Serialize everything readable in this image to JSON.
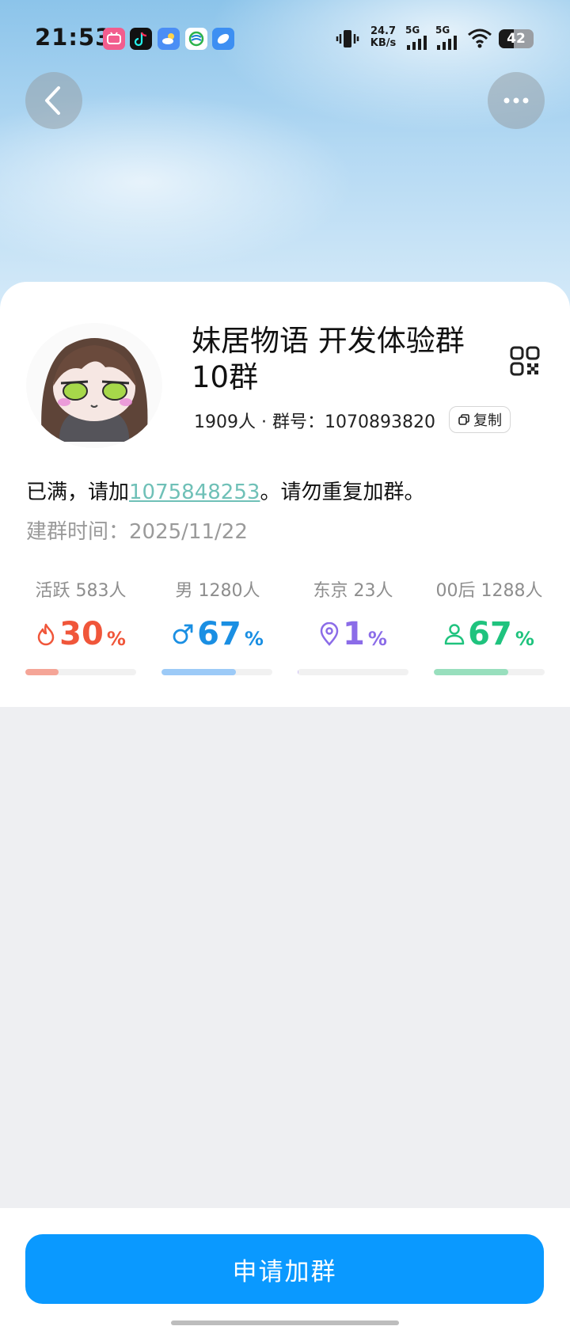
{
  "status_bar": {
    "time": "21:53",
    "net_speed_value": "24.7",
    "net_speed_unit": "KB/s",
    "signal1": "5G",
    "signal2": "5G",
    "battery": "42"
  },
  "group": {
    "name": "妹居物语 开发体验群10群",
    "members": "1909人",
    "id_label": "群号：",
    "id": "1070893820",
    "copy_label": "复制",
    "desc_prefix": "已满，请加",
    "desc_link": "1075848253",
    "desc_suffix": "。请勿重复加群。",
    "created_label": "建群时间：",
    "created_date": "2025/11/22"
  },
  "stats": [
    {
      "label": "活跃 583人",
      "value": "30",
      "unit": "%",
      "fraction": 0.3,
      "color": "#f0563a",
      "bar_color": "#f5a597"
    },
    {
      "label": "男 1280人",
      "value": "67",
      "unit": "%",
      "fraction": 0.67,
      "color": "#1a8fe3",
      "bar_color": "#9ccaf7"
    },
    {
      "label": "东京 23人",
      "value": "1",
      "unit": "%",
      "fraction": 0.01,
      "color": "#8b6ce8",
      "bar_color": "#cbbdf5"
    },
    {
      "label": "00后 1288人",
      "value": "67",
      "unit": "%",
      "fraction": 0.67,
      "color": "#1fc37e",
      "bar_color": "#98dfbd"
    }
  ],
  "join_button": "申请加群"
}
